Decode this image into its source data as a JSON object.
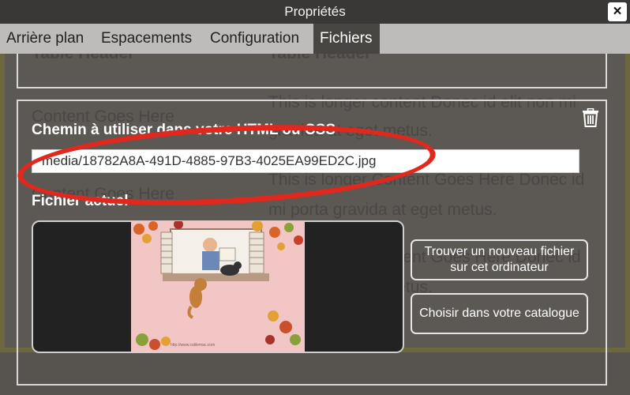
{
  "window": {
    "title": "Propriétés",
    "close_glyph": "×"
  },
  "tabs": [
    {
      "label": "Arrière plan",
      "active": false
    },
    {
      "label": "Espacements",
      "active": false
    },
    {
      "label": "Configuration",
      "active": false
    },
    {
      "label": "Fichiers",
      "active": true
    }
  ],
  "background_page": {
    "header_left": "Table Header",
    "header_right": "Table Header",
    "cell_left_1": "Content Goes Here",
    "cell_left_2": "Content Goes Here",
    "cell_right_1a": "This is longer content Donec id elit non mi",
    "cell_right_1b": "gravida at eget metus.",
    "cell_right_2a": "This is longer Content Goes Here Donec id",
    "cell_right_2b": "mi porta gravida at eget metus.",
    "cell_right_3a": "This is longer content Goes Here Donec id",
    "cell_right_3b": "gravida at eget metus."
  },
  "files": {
    "path_label": "Chemin à utiliser dans votre HTML ou CSS",
    "path_value": "media/18782A8A-491D-4885-97B3-4025EA99ED2C.jpg",
    "current_file_label": "Fichier actuel",
    "thumb_caption": "http://www.calilemac.com",
    "find_button": "Trouver un nouveau fichier sur cet ordinateur",
    "catalog_button": "Choisir dans votre catalogue",
    "icon_delete": "trash-icon"
  },
  "colors": {
    "annotation_ellipse": "#e0281e",
    "active_tab": "#474542"
  }
}
